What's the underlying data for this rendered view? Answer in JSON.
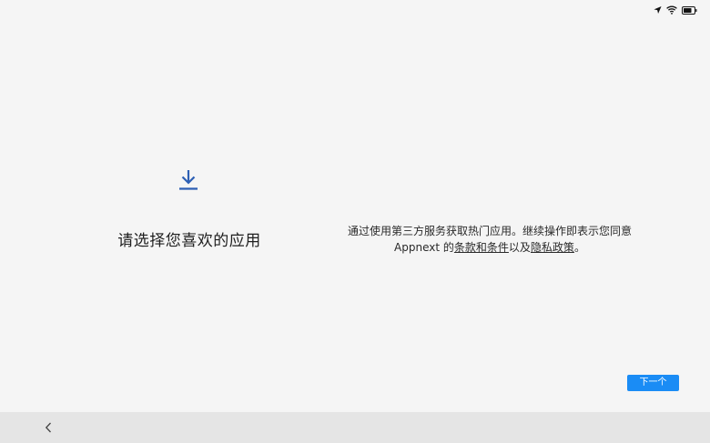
{
  "status_bar": {
    "icons": [
      "location-arrow-icon",
      "wifi-icon",
      "battery-icon"
    ]
  },
  "main": {
    "icon": "download-icon",
    "accent_color": "#2d5fb4",
    "title": "请选择您喜欢的应用",
    "terms": {
      "line1": "通过使用第三方服务获取热门应用。继续操作即表示您同意",
      "brand": "Appnext",
      "possessive": " 的",
      "terms_link": "条款和条件",
      "and_text": "以及",
      "privacy_link": "隐私政策",
      "end_punct": "。"
    }
  },
  "footer": {
    "next_label": "下一个",
    "next_color": "#1a8cf5"
  },
  "nav_bar": {
    "back_icon": "chevron-left-icon"
  }
}
